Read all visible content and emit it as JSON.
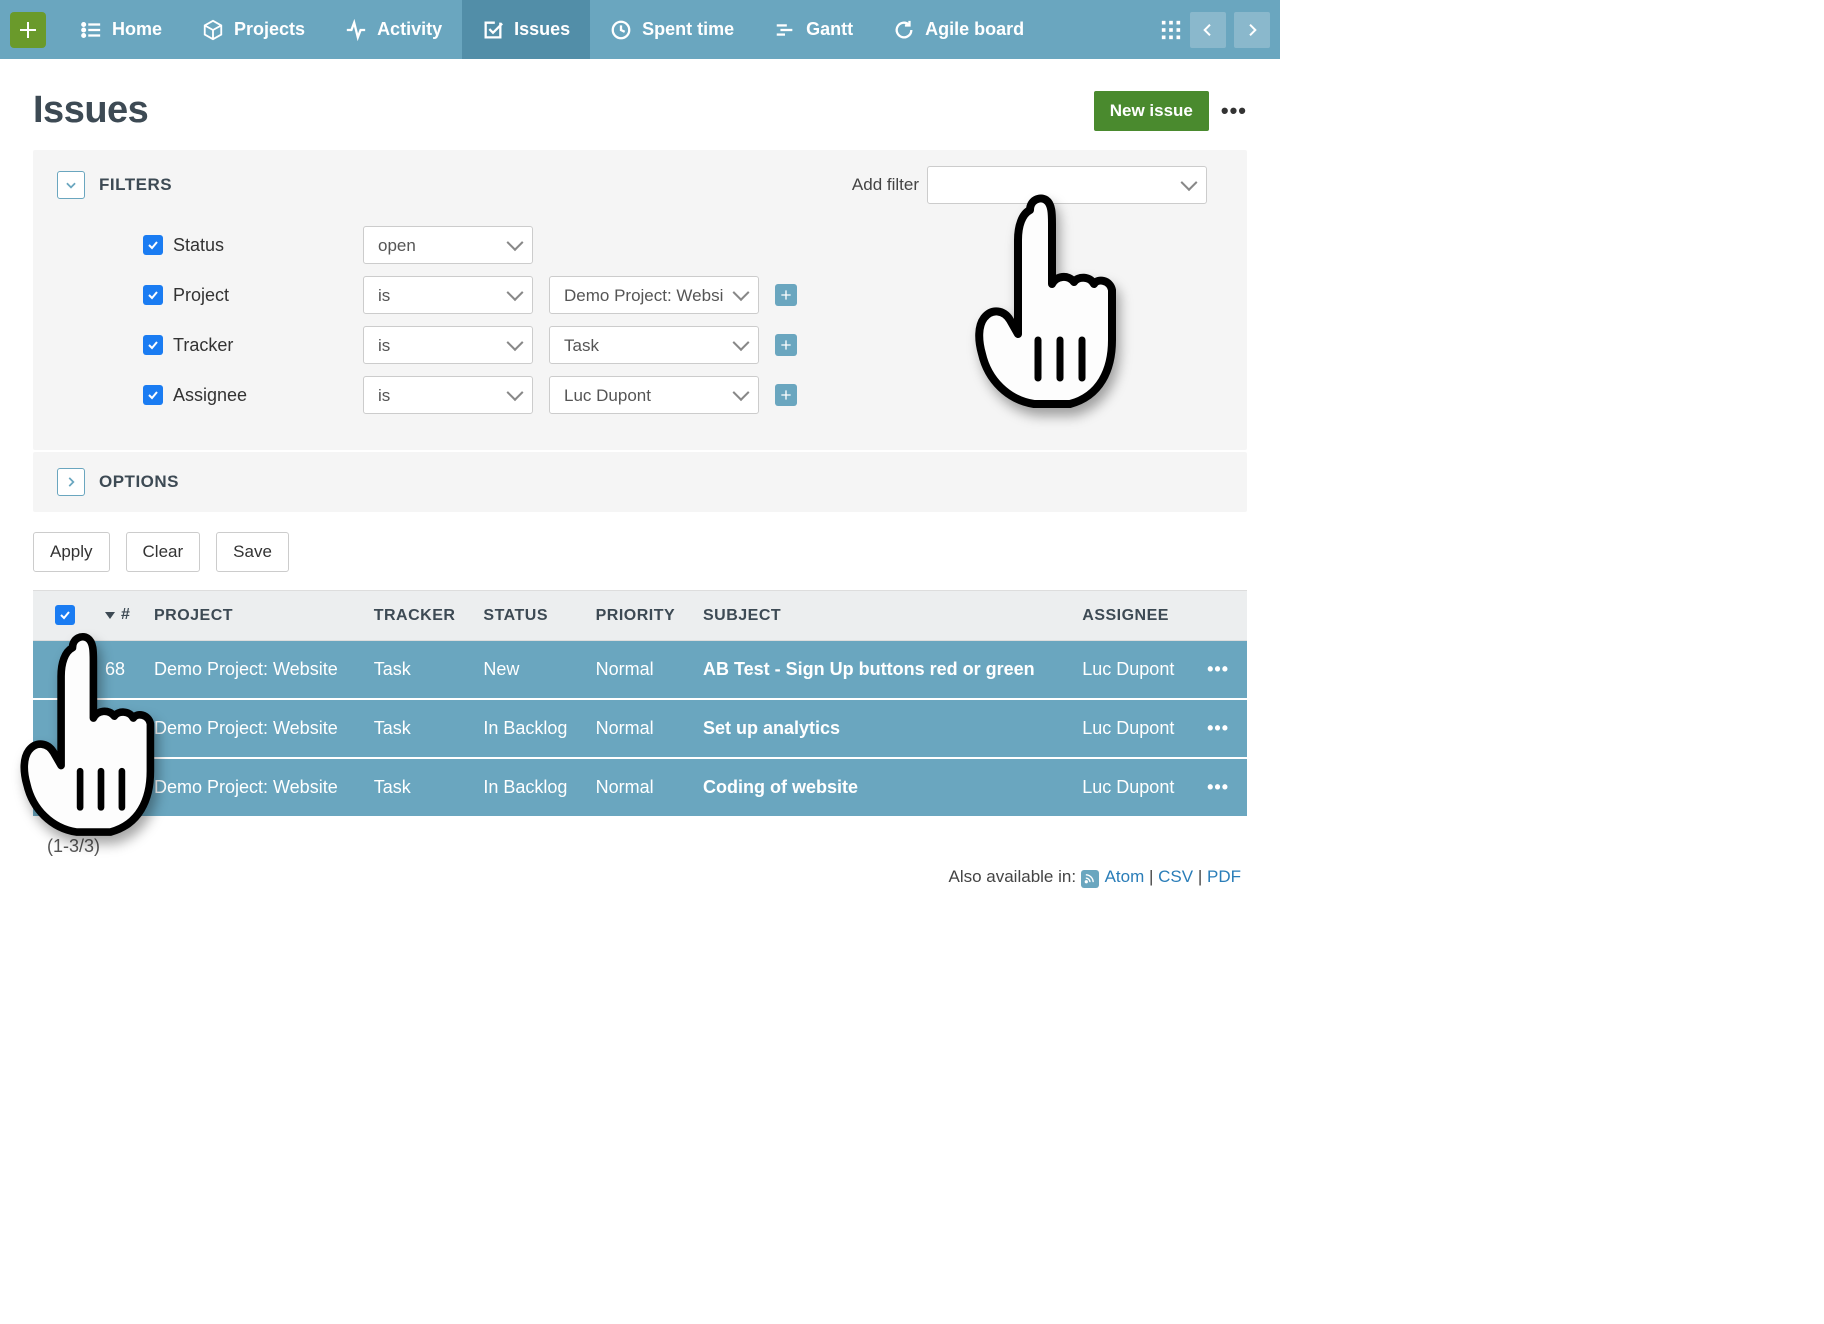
{
  "nav": {
    "items": [
      {
        "label": "Home",
        "icon": "list"
      },
      {
        "label": "Projects",
        "icon": "cube"
      },
      {
        "label": "Activity",
        "icon": "activity"
      },
      {
        "label": "Issues",
        "icon": "check",
        "active": true
      },
      {
        "label": "Spent time",
        "icon": "clock"
      },
      {
        "label": "Gantt",
        "icon": "gantt"
      },
      {
        "label": "Agile board",
        "icon": "refresh"
      }
    ]
  },
  "page": {
    "title": "Issues",
    "new_issue_label": "New issue"
  },
  "filters": {
    "heading": "FILTERS",
    "add_filter_label": "Add filter",
    "rows": [
      {
        "name": "Status",
        "op": "open",
        "val": null
      },
      {
        "name": "Project",
        "op": "is",
        "val": "Demo Project: Websi"
      },
      {
        "name": "Tracker",
        "op": "is",
        "val": "Task"
      },
      {
        "name": "Assignee",
        "op": "is",
        "val": "Luc Dupont"
      }
    ]
  },
  "options": {
    "heading": "OPTIONS"
  },
  "actions": {
    "apply": "Apply",
    "clear": "Clear",
    "save": "Save"
  },
  "table": {
    "cols": [
      "#",
      "PROJECT",
      "TRACKER",
      "STATUS",
      "PRIORITY",
      "SUBJECT",
      "ASSIGNEE"
    ],
    "rows": [
      {
        "id": "68",
        "project": "Demo Project: Website",
        "tracker": "Task",
        "status": "New",
        "priority": "Normal",
        "subject": "AB Test - Sign Up buttons red or green",
        "assignee": "Luc Dupont"
      },
      {
        "id": "",
        "project": "Demo Project: Website",
        "tracker": "Task",
        "status": "In Backlog",
        "priority": "Normal",
        "subject": "Set up analytics",
        "assignee": "Luc Dupont"
      },
      {
        "id": "",
        "project": "Demo Project: Website",
        "tracker": "Task",
        "status": "In Backlog",
        "priority": "Normal",
        "subject": "Coding of website",
        "assignee": "Luc Dupont"
      }
    ]
  },
  "footer": {
    "pager": "(1-3/3)",
    "export_prefix": "Also available in:",
    "atom": "Atom",
    "csv": "CSV",
    "pdf": "PDF"
  }
}
